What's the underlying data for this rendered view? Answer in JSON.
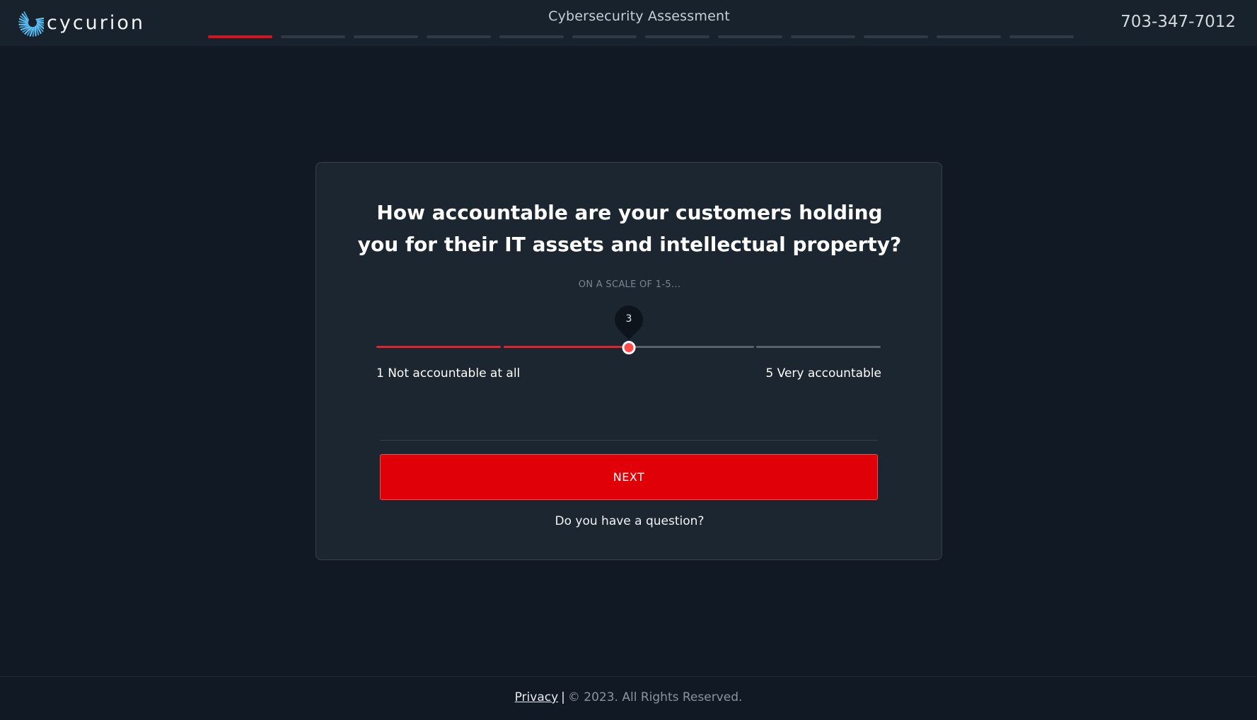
{
  "header": {
    "brand_name": "cycurion",
    "logo_icon": "cycurion-spiral-logo",
    "title": "Cybersecurity Assessment",
    "phone": "703-347-7012",
    "progress": {
      "total_steps": 12,
      "current_step": 1
    },
    "accent_color": "#d6141d"
  },
  "question": {
    "text_line1": "How accountable are your customers holding",
    "text_line2": "you for their IT assets and intellectual property?",
    "scale_hint": "ON A SCALE OF 1-5...",
    "slider": {
      "min": 1,
      "max": 5,
      "value": 3,
      "value_label": "3",
      "min_label": "1 Not accountable at all",
      "max_label": "5 Very accountable"
    },
    "next_label": "NEXT",
    "help_link": "Do you have a question?"
  },
  "footer": {
    "privacy_label": "Privacy",
    "separator": "|",
    "copyright": "© 2023. All Rights Reserved."
  }
}
